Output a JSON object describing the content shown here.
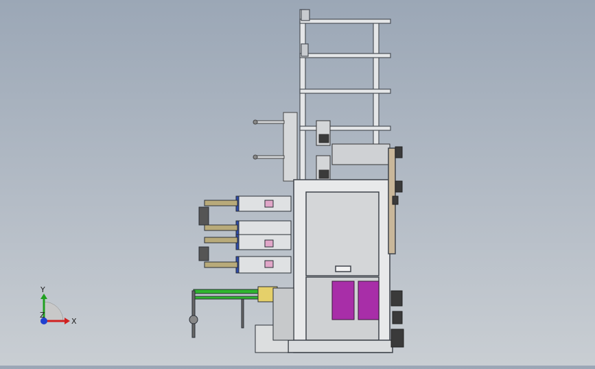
{
  "colors": {
    "background_top": "#9ba7b6",
    "background_bottom": "#c9ced3",
    "frame": "#4a4f57",
    "panel": "#d8dadc",
    "cabinet": "#a82ea8",
    "cylinder": "#2d4aa8",
    "conveyor": "#2fb52f",
    "sensor": "#e5d06a",
    "axis_x": "#d02020",
    "axis_y": "#20a020",
    "axis_z": "#2040d0"
  },
  "triad": {
    "x_label": "X",
    "y_label": "Y",
    "z_label": "Z"
  },
  "icons": {
    "triad": "coordinate-triad-icon"
  }
}
